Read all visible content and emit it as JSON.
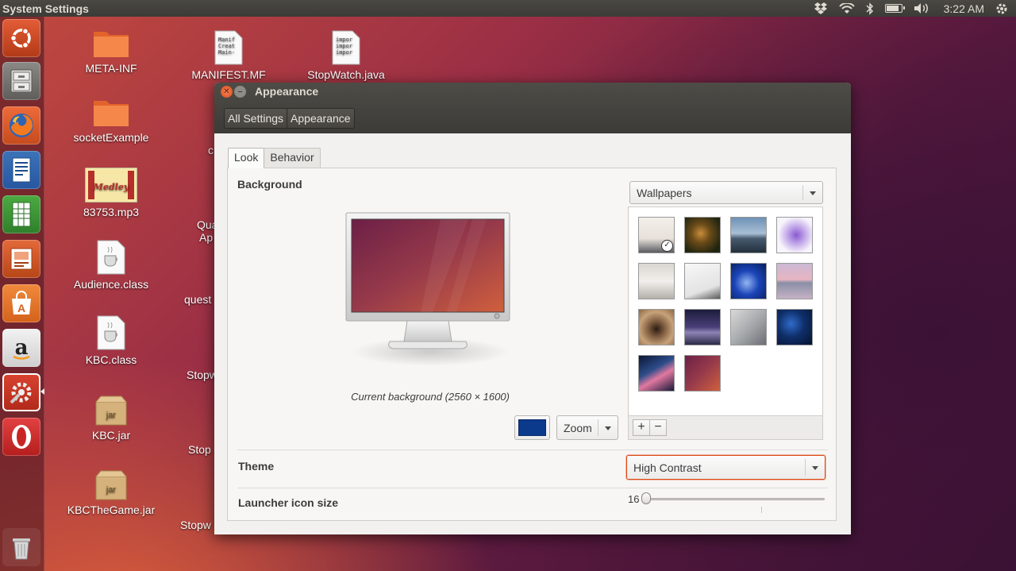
{
  "top_panel": {
    "title": "System Settings",
    "clock": "3:22 AM",
    "tray_icons": [
      "dropbox-icon",
      "wifi-icon",
      "bluetooth-icon",
      "battery-icon",
      "volume-icon"
    ],
    "battery_level": 0.75
  },
  "launcher": {
    "items": [
      "ubuntu-dash",
      "files",
      "firefox",
      "libreoffice-writer",
      "libreoffice-calc",
      "libreoffice-impress",
      "ubuntu-software-center",
      "amazon",
      "system-settings",
      "opera"
    ],
    "trash": "trash"
  },
  "desktop": {
    "icons": [
      {
        "label": "META-INF",
        "type": "folder"
      },
      {
        "label": "socketExample",
        "type": "folder"
      },
      {
        "label": "83753.mp3",
        "type": "audio"
      },
      {
        "label": "Audience.class",
        "type": "java-class"
      },
      {
        "label": "KBC.class",
        "type": "java-class"
      },
      {
        "label": "KBC.jar",
        "type": "jar"
      },
      {
        "label": "KBCTheGame.jar",
        "type": "jar"
      },
      {
        "label": "MANIFEST.MF",
        "type": "text"
      },
      {
        "label": "StopWatch.java",
        "type": "text"
      }
    ],
    "jar_badge": "jar",
    "mp3_thumb_text": "Medley",
    "manifest_lines": [
      "Manif",
      "Creat",
      "Main-"
    ],
    "java_lines": [
      "impor",
      "impor",
      "impor"
    ],
    "partial_labels": [
      "c",
      "Qua",
      "Ap",
      "quest",
      "Stopw",
      "Stop",
      "Stopw"
    ]
  },
  "window": {
    "title": "Appearance",
    "breadcrumbs": [
      "All Settings",
      "Appearance"
    ],
    "tabs": [
      "Look",
      "Behavior"
    ],
    "active_tab": "Look",
    "background": {
      "label": "Background",
      "caption": "Current background (2560 × 1600)",
      "source_select": "Wallpapers",
      "color": "#0b3a8c",
      "placement_select": "Zoom",
      "add_label": "+",
      "remove_label": "−"
    },
    "theme": {
      "label": "Theme",
      "value": "High Contrast"
    },
    "launcher_icon_size": {
      "label": "Launcher icon size",
      "value": "16"
    }
  },
  "colors": {
    "accent": "#dd4814",
    "panel_dark": "#3c3b37",
    "bg_color_swatch": "#0b3a8c"
  }
}
